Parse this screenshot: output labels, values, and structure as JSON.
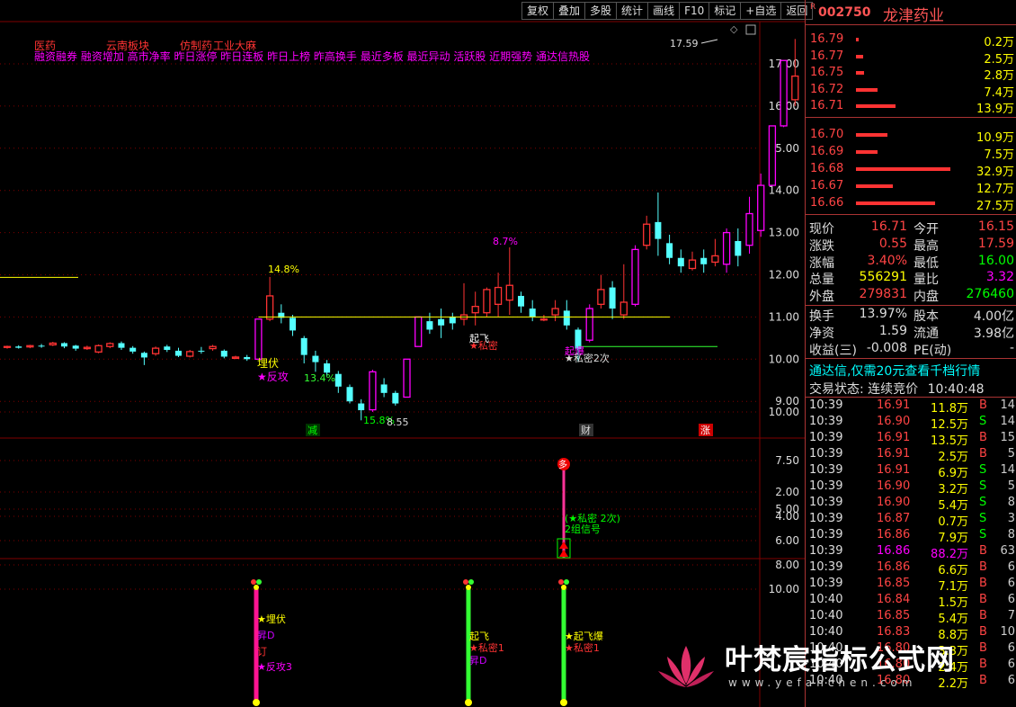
{
  "toolbar": {
    "items": [
      "复权",
      "叠加",
      "多股",
      "统计",
      "画线",
      "F10",
      "标记",
      "+自选",
      "返回"
    ]
  },
  "stock": {
    "r": "R",
    "code": "002750",
    "name": "龙津药业"
  },
  "colors": {
    "up": "#ff3333",
    "down": "#54ffff",
    "magenta": "#ff00ff",
    "yellow": "#ffff00",
    "green": "#33ff33",
    "grid": "#7f0000"
  },
  "concepts": {
    "row1": [
      "医药",
      "云南板块",
      "仿制药",
      "工业大麻"
    ],
    "row2": "融资融券 融资增加 高市净率 昨日涨停 昨日连板 昨日上榜 昨高换手 最近多板 最近异动 活跃股 近期强势 通达信热股"
  },
  "main_axis": {
    "labels": [
      "17.00",
      "16.00",
      "15.00",
      "14.00",
      "13.00",
      "12.00",
      "11.00",
      "10.00",
      "9.00"
    ]
  },
  "ind1_axis": {
    "labels": [
      "10.00",
      "7.50",
      "5.00"
    ]
  },
  "ind2_axis": {
    "labels": [
      "10.00",
      "8.00",
      "6.00",
      "4.00",
      "2.00"
    ]
  },
  "chart_data": {
    "type": "candlestick",
    "ylim": [
      8.55,
      17.59
    ],
    "candles": [
      [
        10.28,
        10.3,
        10.25,
        10.32
      ],
      [
        10.3,
        10.27,
        10.25,
        10.33
      ],
      [
        10.29,
        10.32,
        10.26,
        10.34
      ],
      [
        10.32,
        10.3,
        10.27,
        10.36
      ],
      [
        10.34,
        10.38,
        10.31,
        10.41
      ],
      [
        10.38,
        10.3,
        10.26,
        10.4
      ],
      [
        10.32,
        10.25,
        10.2,
        10.34
      ],
      [
        10.25,
        10.28,
        10.22,
        10.32
      ],
      [
        10.17,
        10.32,
        10.14,
        10.35
      ],
      [
        10.3,
        10.37,
        10.26,
        10.4
      ],
      [
        10.38,
        10.27,
        10.22,
        10.42
      ],
      [
        10.27,
        10.18,
        10.13,
        10.31
      ],
      [
        10.15,
        10.04,
        9.86,
        10.18
      ],
      [
        10.13,
        10.26,
        10.08,
        10.3
      ],
      [
        10.3,
        10.22,
        10.17,
        10.34
      ],
      [
        10.2,
        10.08,
        10.05,
        10.27
      ],
      [
        10.07,
        10.18,
        10.04,
        10.22
      ],
      [
        10.2,
        10.18,
        10.13,
        10.29
      ],
      [
        10.25,
        10.3,
        10.2,
        10.34
      ],
      [
        10.2,
        10.06,
        10.02,
        10.23
      ],
      [
        10.02,
        10.05,
        10.0,
        10.08
      ],
      [
        10.05,
        10.0,
        9.96,
        10.1
      ],
      [
        10.0,
        10.95,
        10.0,
        10.95
      ],
      [
        10.95,
        11.5,
        10.9,
        11.95
      ],
      [
        11.1,
        10.98,
        10.85,
        11.3
      ],
      [
        10.98,
        10.68,
        10.55,
        11.05
      ],
      [
        10.5,
        10.1,
        9.9,
        10.55
      ],
      [
        10.08,
        9.93,
        9.7,
        10.2
      ],
      [
        9.9,
        9.68,
        9.6,
        9.98
      ],
      [
        9.65,
        9.35,
        9.2,
        9.72
      ],
      [
        9.34,
        9.0,
        8.95,
        9.4
      ],
      [
        8.95,
        8.79,
        8.55,
        9.05
      ],
      [
        8.8,
        9.7,
        8.75,
        9.75
      ],
      [
        9.4,
        9.2,
        9.1,
        9.55
      ],
      [
        9.2,
        8.95,
        8.9,
        9.25
      ],
      [
        9.1,
        10.0,
        9.1,
        10.0
      ],
      [
        10.3,
        11.0,
        10.3,
        11.0
      ],
      [
        10.9,
        10.7,
        10.6,
        11.1
      ],
      [
        10.95,
        10.8,
        10.5,
        11.2
      ],
      [
        11.0,
        10.85,
        10.7,
        11.1
      ],
      [
        10.95,
        11.05,
        10.8,
        11.8
      ],
      [
        11.1,
        11.25,
        10.8,
        11.6
      ],
      [
        11.1,
        11.65,
        11.0,
        11.7
      ],
      [
        11.3,
        11.7,
        11.0,
        12.05
      ],
      [
        11.4,
        11.75,
        11.05,
        12.65
      ],
      [
        11.5,
        11.25,
        11.1,
        11.6
      ],
      [
        11.2,
        11.0,
        10.9,
        11.4
      ],
      [
        10.95,
        10.95,
        10.9,
        11.05
      ],
      [
        11.05,
        11.2,
        10.9,
        11.4
      ],
      [
        11.15,
        10.8,
        10.7,
        11.4
      ],
      [
        10.7,
        10.25,
        9.93,
        10.75
      ],
      [
        10.45,
        11.2,
        10.4,
        11.3
      ],
      [
        11.3,
        11.65,
        11.2,
        12.0
      ],
      [
        11.7,
        11.2,
        10.95,
        11.85
      ],
      [
        11.05,
        11.35,
        10.95,
        12.25
      ],
      [
        11.3,
        12.6,
        11.25,
        12.7
      ],
      [
        12.7,
        13.2,
        12.6,
        13.4
      ],
      [
        13.25,
        12.85,
        12.45,
        13.95
      ],
      [
        12.75,
        12.4,
        12.25,
        12.95
      ],
      [
        12.4,
        12.2,
        12.05,
        12.6
      ],
      [
        12.15,
        12.35,
        12.1,
        12.55
      ],
      [
        12.4,
        12.25,
        12.05,
        12.6
      ],
      [
        12.3,
        12.45,
        12.2,
        12.85
      ],
      [
        12.25,
        13.0,
        12.05,
        13.1
      ],
      [
        12.8,
        12.45,
        12.2,
        13.1
      ],
      [
        12.7,
        13.45,
        12.5,
        13.85
      ],
      [
        13.05,
        14.12,
        12.9,
        14.4
      ],
      [
        14.12,
        15.53,
        14.12,
        15.53
      ],
      [
        15.53,
        17.08,
        15.5,
        17.08
      ],
      [
        16.15,
        16.71,
        16.0,
        17.59
      ]
    ],
    "annotations": [
      "17.59",
      "14.8%",
      "13.4%",
      "15.8%",
      "8.55",
      "8.7%",
      "埋伏",
      "★反攻",
      "起飞",
      "★私密",
      "起爆",
      "★私密2次",
      "减",
      "财",
      "涨"
    ],
    "levels": [
      11.0,
      10.3
    ]
  },
  "ind1": {
    "badge": "多",
    "signal_text": "(★私密 2次)",
    "group_text": "2组信号"
  },
  "ind2": {
    "g1": [
      "★埋伏",
      "昇D",
      "订",
      "★反攻3"
    ],
    "g2": [
      "起飞",
      "★私密1",
      "昇D"
    ],
    "g3": [
      "★起飞爆",
      "★私密1"
    ]
  },
  "orderbook": {
    "asks": [
      [
        "16.79",
        "0.2万",
        0.6
      ],
      [
        "16.77",
        "2.5万",
        7.6
      ],
      [
        "16.75",
        "2.8万",
        8.5
      ],
      [
        "16.72",
        "7.4万",
        22.5
      ],
      [
        "16.71",
        "13.9万",
        42.2
      ]
    ],
    "bids": [
      [
        "16.70",
        "10.9万",
        33.1
      ],
      [
        "16.69",
        "7.5万",
        22.8
      ],
      [
        "16.68",
        "32.9万",
        100
      ],
      [
        "16.67",
        "12.7万",
        38.6
      ],
      [
        "16.66",
        "27.5万",
        83.6
      ]
    ]
  },
  "quote": [
    [
      "现价",
      "16.71",
      "今开",
      "16.15",
      "#f44",
      "#f44"
    ],
    [
      "涨跌",
      "0.55",
      "最高",
      "17.59",
      "#f44",
      "#f44"
    ],
    [
      "涨幅",
      "3.40%",
      "最低",
      "16.00",
      "#f44",
      "#0f0"
    ],
    [
      "总量",
      "556291",
      "量比",
      "3.32",
      "#ff0",
      "#f0f"
    ],
    [
      "外盘",
      "279831",
      "内盘",
      "276460",
      "#f44",
      "#0f0"
    ]
  ],
  "quote2": [
    [
      "换手",
      "13.97%",
      "股本",
      "4.00亿",
      "#ddd",
      "#ddd"
    ],
    [
      "净资",
      "1.59",
      "流通",
      "3.98亿",
      "#ddd",
      "#ddd"
    ],
    [
      "收益(三)",
      "-0.008",
      "PE(动)",
      "-",
      "#ddd",
      "#ddd"
    ]
  ],
  "notice": "通达信,仅需20元查看千档行情",
  "status": {
    "label": "交易状态: 连续竞价",
    "time": "10:40:48"
  },
  "trades": [
    [
      "10:39",
      "16.91",
      "11.8万",
      "B",
      "14"
    ],
    [
      "10:39",
      "16.90",
      "12.5万",
      "S",
      "14"
    ],
    [
      "10:39",
      "16.91",
      "13.5万",
      "B",
      "15"
    ],
    [
      "10:39",
      "16.91",
      "2.5万",
      "B",
      "5"
    ],
    [
      "10:39",
      "16.91",
      "6.9万",
      "S",
      "14"
    ],
    [
      "10:39",
      "16.90",
      "3.2万",
      "S",
      "5"
    ],
    [
      "10:39",
      "16.90",
      "5.4万",
      "S",
      "8"
    ],
    [
      "10:39",
      "16.87",
      "0.7万",
      "S",
      "3"
    ],
    [
      "10:39",
      "16.86",
      "7.9万",
      "S",
      "8"
    ],
    [
      "10:39",
      "16.86",
      "88.2万",
      "B",
      "63"
    ],
    [
      "10:39",
      "16.86",
      "6.6万",
      "B",
      "6"
    ],
    [
      "10:39",
      "16.85",
      "7.1万",
      "B",
      "6"
    ],
    [
      "10:40",
      "16.84",
      "1.5万",
      "B",
      "6"
    ],
    [
      "10:40",
      "16.85",
      "5.4万",
      "B",
      "7"
    ],
    [
      "10:40",
      "16.83",
      "8.8万",
      "B",
      "10"
    ],
    [
      "10:40",
      "16.80",
      "3.3万",
      "B",
      "6"
    ],
    [
      "10:40",
      "16.80",
      "2.4万",
      "B",
      "6"
    ],
    [
      "10:40",
      "16.80",
      "2.2万",
      "B",
      "6"
    ]
  ],
  "watermark": {
    "title": "叶梵宸指标公式网",
    "url": "www.yefanchen.com"
  }
}
